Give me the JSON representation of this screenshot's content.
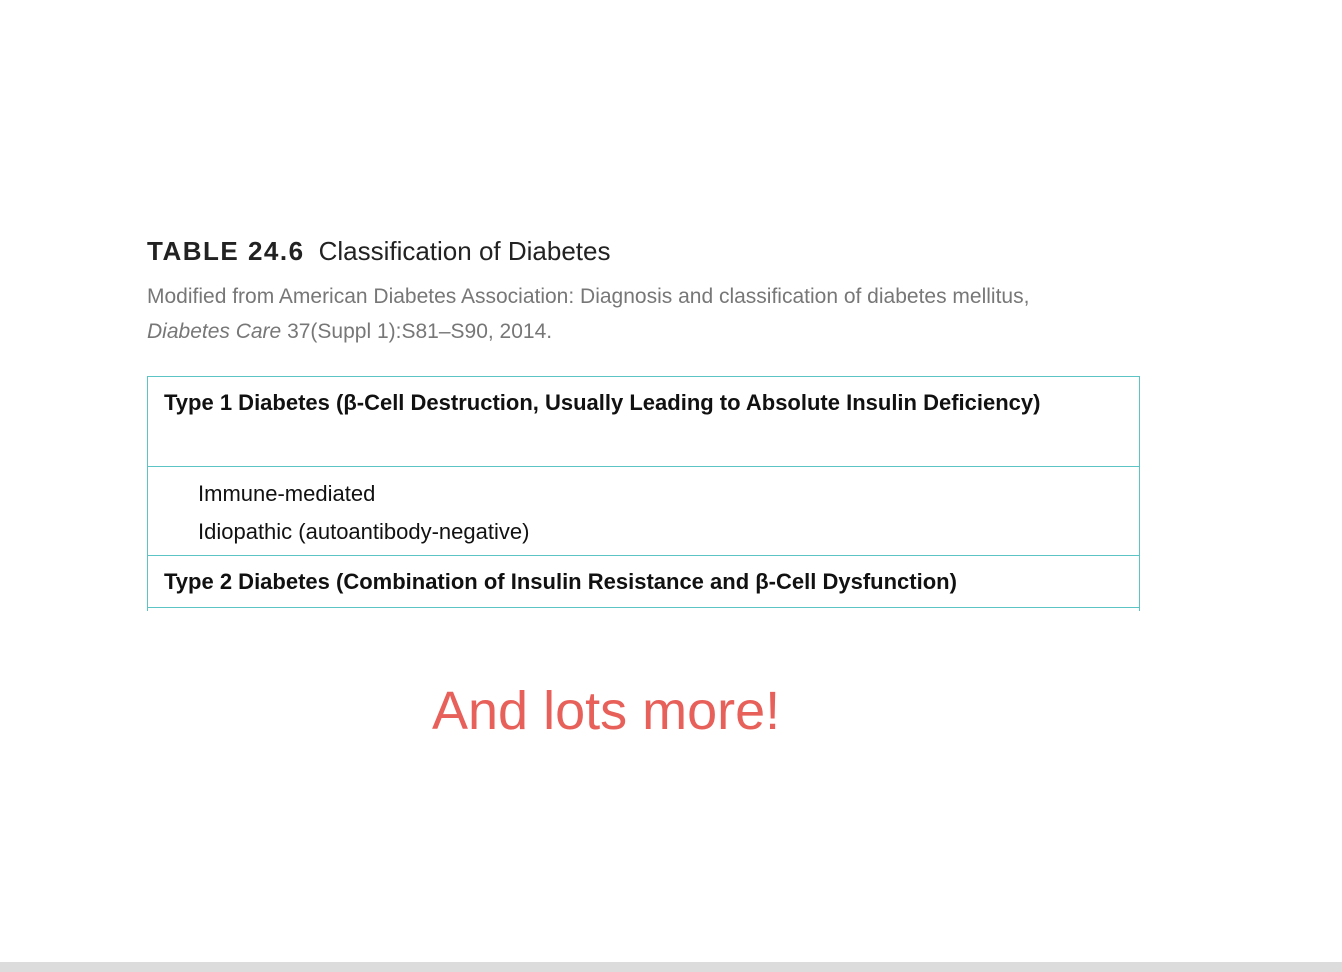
{
  "table_caption": {
    "number": "TABLE 24.6",
    "title": "Classification of Diabetes"
  },
  "citation": {
    "line1": "Modified from American Diabetes Association: Diagnosis and classification of diabetes mellitus,",
    "journal": "Diabetes Care",
    "line2_rest": " 37(Suppl 1):S81–S90, 2014."
  },
  "rows": [
    {
      "header": "Type 1 Diabetes (β-Cell Destruction, Usually Leading to Absolute Insulin Deficiency)"
    },
    {
      "items": [
        "Immune-mediated",
        "Idiopathic (autoantibody-negative)"
      ]
    },
    {
      "header": "Type 2 Diabetes (Combination of Insulin Resistance and β-Cell Dysfunction)"
    }
  ],
  "callout": "And lots more!",
  "colors": {
    "table_border": "#5cc4c4",
    "callout": "#e8605a"
  }
}
